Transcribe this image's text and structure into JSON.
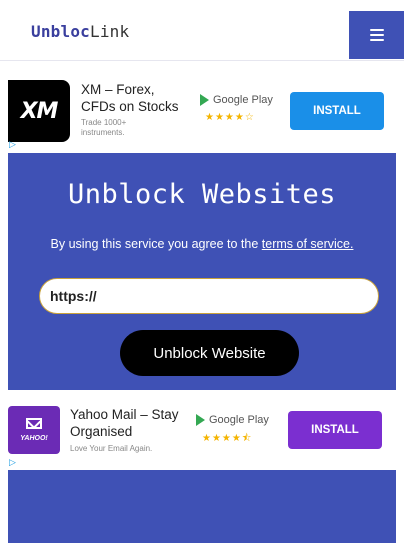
{
  "header": {
    "logo_bold": "Unbloc",
    "logo_rest": "Link",
    "menu_icon": "hamburger-icon"
  },
  "ads": [
    {
      "icon": "xm-logo-icon",
      "icon_text": "XM",
      "title": "XM – Forex, CFDs on Stocks",
      "subtitle": "Trade 1000+ instruments.",
      "store": "Google Play",
      "stars": "★★★★☆",
      "install_label": "INSTALL",
      "install_color": "#1a8fe8"
    },
    {
      "icon": "yahoo-mail-icon",
      "icon_text": "YAHOO!",
      "title": "Yahoo Mail – Stay Organised",
      "subtitle": "Love Your Email Again.",
      "store": "Google Play",
      "stars": "★★★★⯪",
      "install_label": "INSTALL",
      "install_color": "#7b2fd0"
    }
  ],
  "hero": {
    "title": "Unblock Websites",
    "agree_text": "By using this service you agree to the ",
    "terms_link": "terms of service.",
    "url_value": "https://",
    "button_label": "Unblock Website"
  },
  "colors": {
    "primary": "#3f51b5",
    "button": "#000000"
  }
}
